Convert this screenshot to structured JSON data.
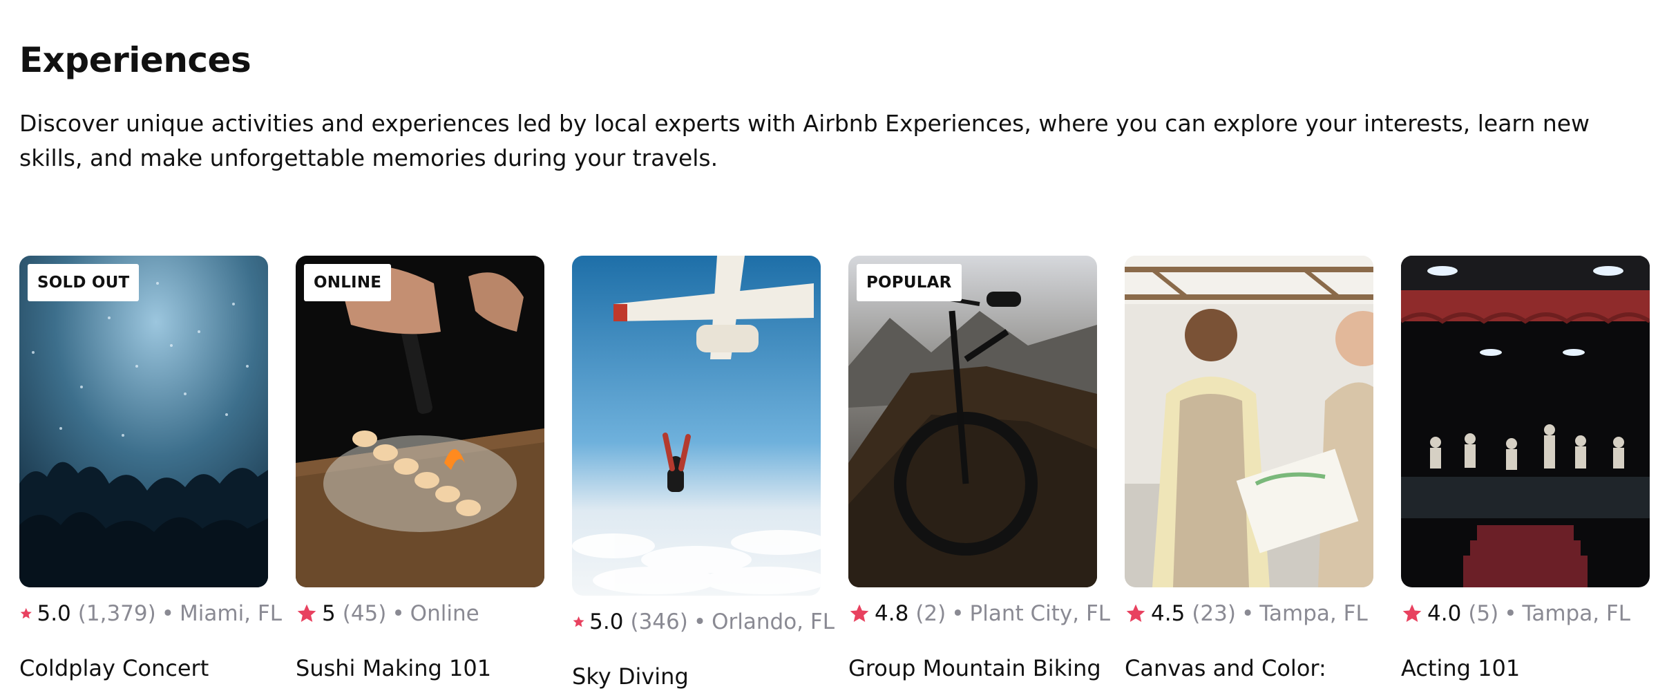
{
  "section": {
    "title": "Experiences",
    "description": "Discover unique activities and experiences led by local experts with Airbnb Experiences, where you can explore your interests, learn new skills, and make unforgettable memories during your travels."
  },
  "icons": {
    "rating": "star-icon"
  },
  "colors": {
    "star": "#e8415f",
    "muted_text": "#8a8a93",
    "text": "#111111"
  },
  "cards": [
    {
      "badge": "SOLD OUT",
      "rating": "5.0",
      "count": "(1,379)",
      "separator": "•",
      "location": "Miami, FL",
      "name": "Coldplay Concert"
    },
    {
      "badge": "ONLINE",
      "rating": "5",
      "count": "(45)",
      "separator": "•",
      "location": "Online",
      "name": "Sushi Making 101"
    },
    {
      "badge": "",
      "rating": "5.0",
      "count": "(346)",
      "separator": "•",
      "location": "Orlando, FL",
      "name": "Sky Diving"
    },
    {
      "badge": "POPULAR",
      "rating": "4.8",
      "count": "(2)",
      "separator": "•",
      "location": "Plant City, FL",
      "name": "Group Mountain Biking"
    },
    {
      "badge": "",
      "rating": "4.5",
      "count": "(23)",
      "separator": "•",
      "location": "Tampa, FL",
      "name": "Canvas and Color:"
    },
    {
      "badge": "",
      "rating": "4.0",
      "count": "(5)",
      "separator": "•",
      "location": "Tampa, FL",
      "name": "Acting 101"
    }
  ]
}
